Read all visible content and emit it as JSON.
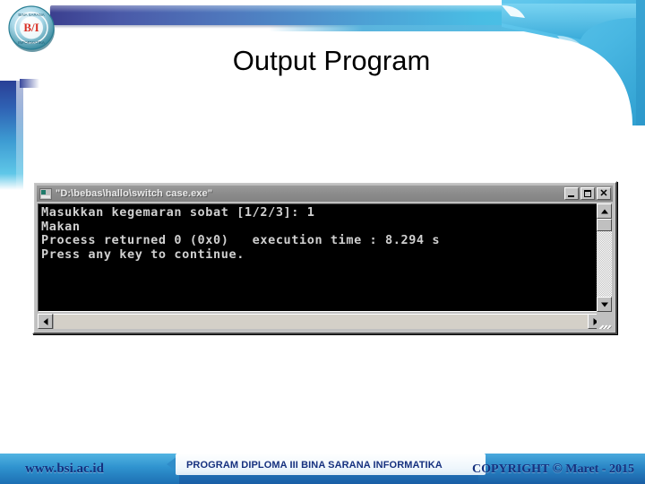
{
  "slide": {
    "title": "Output Program",
    "logo_alt": "bsi-seal-logo",
    "logo_initials": "B/I"
  },
  "console": {
    "titlebar": {
      "icon": "console-window-icon",
      "title": "\"D:\\bebas\\hallo\\switch case.exe\"",
      "minimize_label": "_",
      "maximize_label": "□",
      "close_label": "✕"
    },
    "lines": [
      "Masukkan kegemaran sobat [1/2/3]: 1",
      "Makan",
      "Process returned 0 (0x0)   execution time : 8.294 s",
      "Press any key to continue."
    ],
    "scrollbars": {
      "up_arrow": "scroll-up-arrow",
      "down_arrow": "scroll-down-arrow",
      "left_arrow": "scroll-left-arrow",
      "right_arrow": "scroll-right-arrow",
      "resize_grip": "resize-grip"
    }
  },
  "footer": {
    "url": "www.bsi.ac.id",
    "center": "PROGRAM DIPLOMA III BINA SARANA INFORMATIKA",
    "copyright_prefix": "COPYRIGHT",
    "copyright_symbol": "©",
    "copyright_suffix": "Maret - 2015"
  },
  "colors": {
    "ribbon_start": "#3b3f8f",
    "ribbon_end": "#4ec8ec",
    "footer_blue": "#1f6fb4",
    "footer_text": "#16317f",
    "console_gray": "#c0c0c0",
    "terminal_bg": "#000000",
    "terminal_fg": "#d0d0d0",
    "logo_red": "#d93025"
  }
}
